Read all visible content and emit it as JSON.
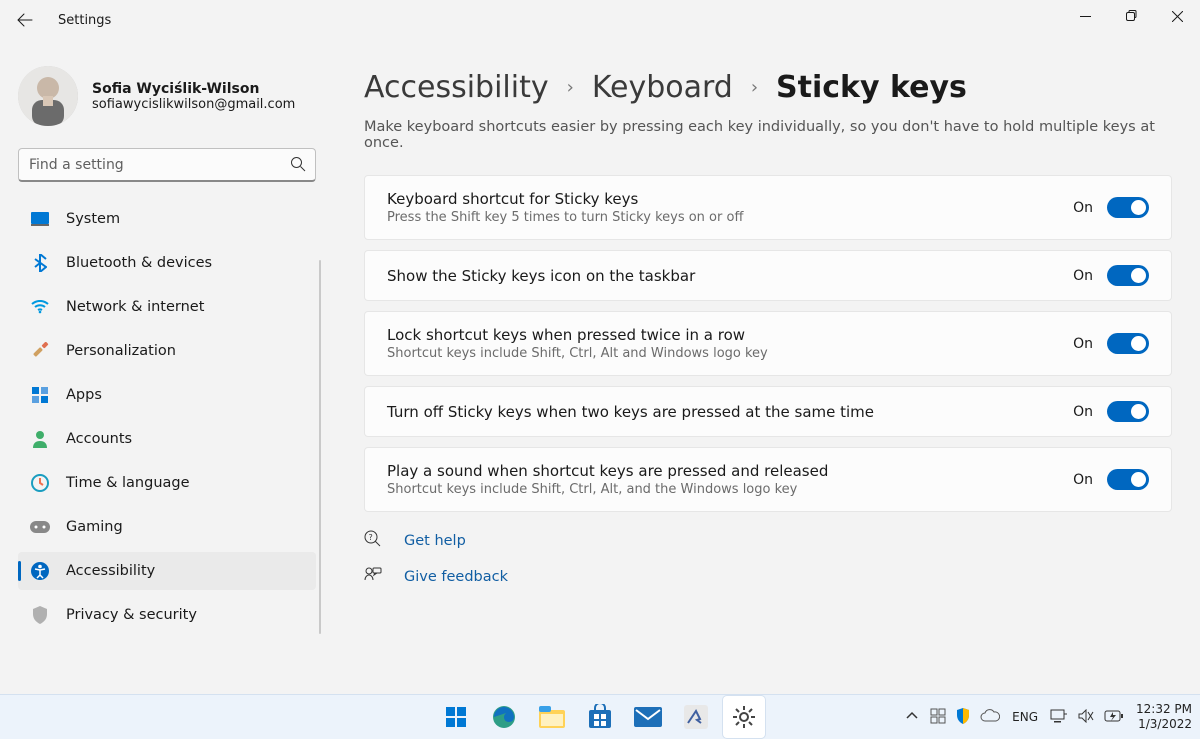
{
  "window": {
    "title": "Settings"
  },
  "user": {
    "name": "Sofia Wyciślik-Wilson",
    "email": "sofiawycislikwilson@gmail.com"
  },
  "search": {
    "placeholder": "Find a setting"
  },
  "nav": [
    {
      "label": "System",
      "icon": "system"
    },
    {
      "label": "Bluetooth & devices",
      "icon": "bluetooth"
    },
    {
      "label": "Network & internet",
      "icon": "wifi"
    },
    {
      "label": "Personalization",
      "icon": "paint"
    },
    {
      "label": "Apps",
      "icon": "apps"
    },
    {
      "label": "Accounts",
      "icon": "account"
    },
    {
      "label": "Time & language",
      "icon": "time"
    },
    {
      "label": "Gaming",
      "icon": "gaming"
    },
    {
      "label": "Accessibility",
      "icon": "accessibility",
      "active": true
    },
    {
      "label": "Privacy & security",
      "icon": "shield"
    }
  ],
  "breadcrumb": {
    "a": "Accessibility",
    "b": "Keyboard",
    "c": "Sticky keys"
  },
  "description": "Make keyboard shortcuts easier by pressing each key individually, so you don't have to hold multiple keys at once.",
  "settings": [
    {
      "title": "Keyboard shortcut for Sticky keys",
      "sub": "Press the Shift key 5 times to turn Sticky keys on or off",
      "state": "On"
    },
    {
      "title": "Show the Sticky keys icon on the taskbar",
      "sub": "",
      "state": "On"
    },
    {
      "title": "Lock shortcut keys when pressed twice in a row",
      "sub": "Shortcut keys include Shift, Ctrl, Alt and Windows logo key",
      "state": "On"
    },
    {
      "title": "Turn off Sticky keys when two keys are pressed at the same time",
      "sub": "",
      "state": "On"
    },
    {
      "title": "Play a sound when shortcut keys are pressed and released",
      "sub": "Shortcut keys include Shift, Ctrl, Alt, and the Windows logo key",
      "state": "On"
    }
  ],
  "links": {
    "help": "Get help",
    "feedback": "Give feedback"
  },
  "taskbar": {
    "lang": "ENG",
    "time": "12:32 PM",
    "date": "1/3/2022"
  }
}
